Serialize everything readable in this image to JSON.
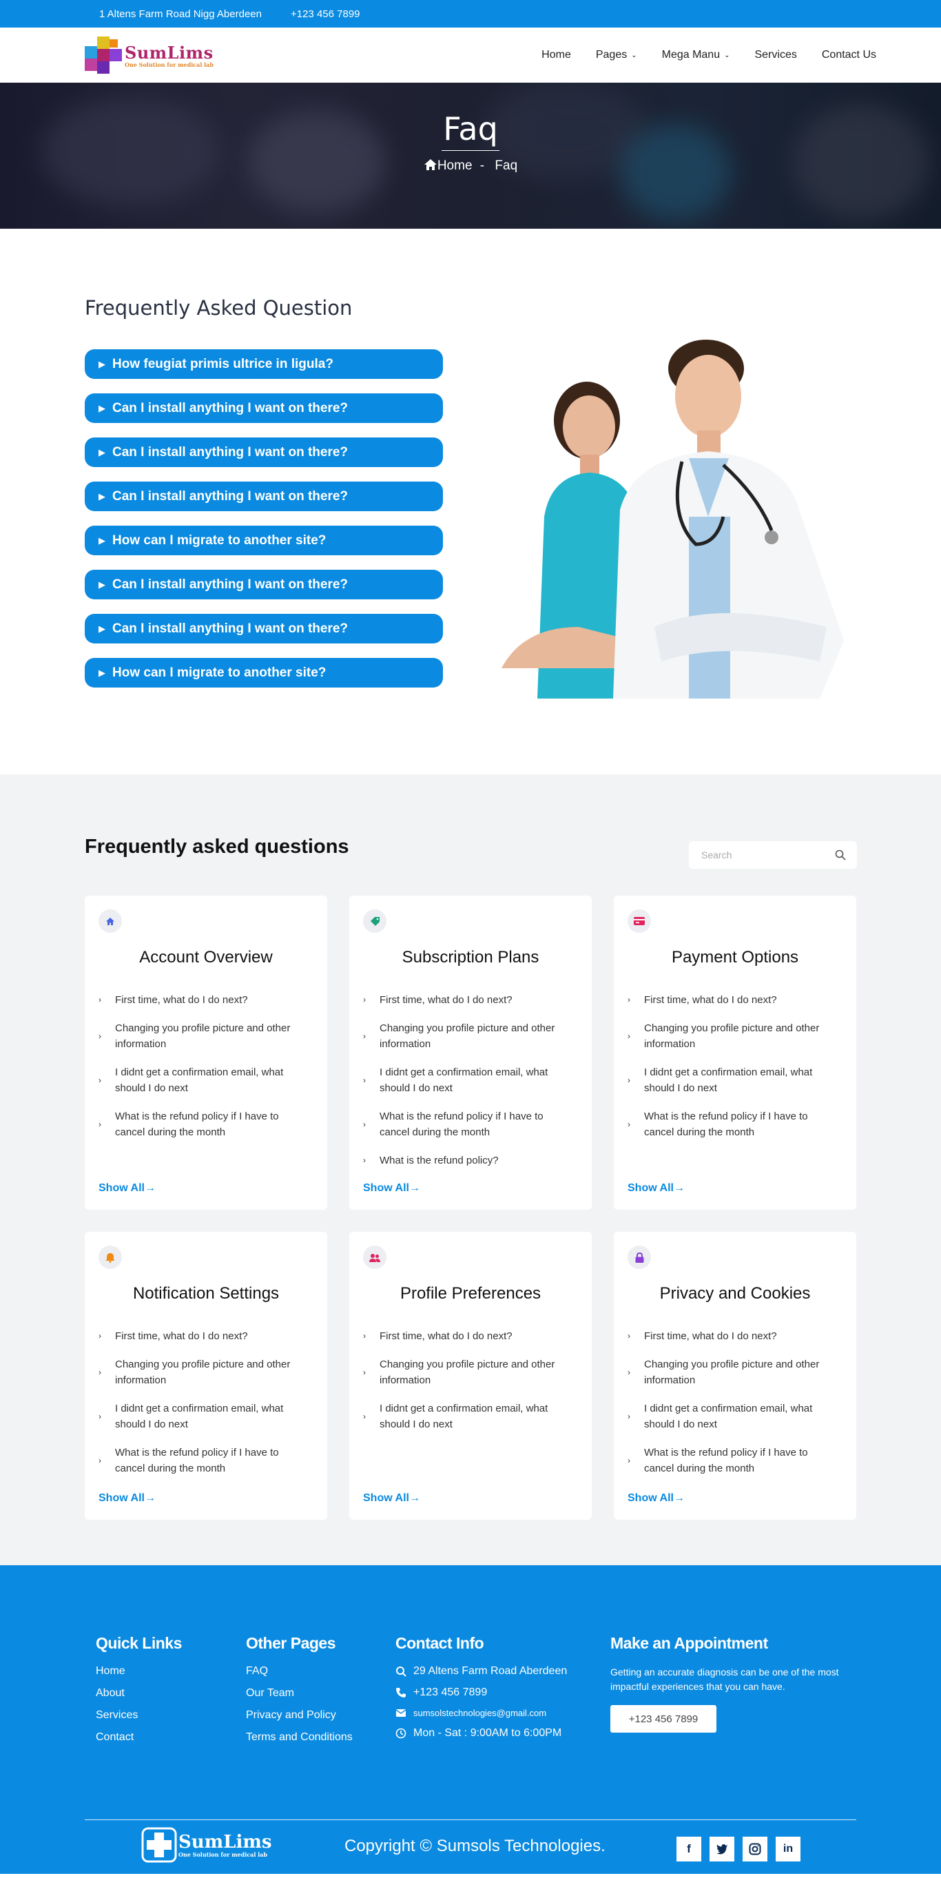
{
  "topbar": {
    "address": "1 Altens Farm Road Nigg Aberdeen",
    "phone": "+123 456 7899"
  },
  "brand": {
    "name": "SumLims",
    "tagline": "One Solution for medical lab"
  },
  "nav": [
    {
      "label": "Home",
      "dropdown": false
    },
    {
      "label": "Pages",
      "dropdown": true
    },
    {
      "label": "Mega Manu",
      "dropdown": true
    },
    {
      "label": "Services",
      "dropdown": false
    },
    {
      "label": "Contact Us",
      "dropdown": false
    }
  ],
  "hero": {
    "title": "Faq",
    "crumb_home": "Home",
    "crumb_sep": "-",
    "crumb_current": "Faq"
  },
  "faq_accordion": {
    "heading": "Frequently Asked Question",
    "items": [
      "How feugiat primis ultrice in ligula?",
      "Can I install anything I want on there?",
      "Can I install anything I want on there?",
      "Can I install anything I want on there?",
      "How can I migrate to another site?",
      "Can I install anything I want on there?",
      "Can I install anything I want on there?",
      "How can I migrate to another site?"
    ]
  },
  "faq_cards": {
    "heading": "Frequently asked questions",
    "search_placeholder": "Search",
    "show_all": "Show All",
    "cards": [
      {
        "title": "Account Overview",
        "icon": "home-icon",
        "icon_color": "#4a63e0",
        "items": [
          "First time, what do I do next?",
          "Changing you profile picture and other information",
          "I didnt get a confirmation email, what should I do next",
          "What is the refund policy if I have to cancel during the month"
        ]
      },
      {
        "title": "Subscription Plans",
        "icon": "tag-icon",
        "icon_color": "#1aa07a",
        "items": [
          "First time, what do I do next?",
          "Changing you profile picture and other information",
          "I didnt get a confirmation email, what should I do next",
          "What is the refund policy if I have to cancel during the month",
          "What is the refund policy?"
        ]
      },
      {
        "title": "Payment Options",
        "icon": "credit-card-icon",
        "icon_color": "#e0245e",
        "items": [
          "First time, what do I do next?",
          "Changing you profile picture and other information",
          "I didnt get a confirmation email, what should I do next",
          "What is the refund policy if I have to cancel during the month"
        ]
      },
      {
        "title": "Notification Settings",
        "icon": "bell-icon",
        "icon_color": "#f08a12",
        "items": [
          "First time, what do I do next?",
          "Changing you profile picture and other information",
          "I didnt get a confirmation email, what should I do next",
          "What is the refund policy if I have to cancel during the month"
        ]
      },
      {
        "title": "Profile Preferences",
        "icon": "users-icon",
        "icon_color": "#e0245e",
        "items": [
          "First time, what do I do next?",
          "Changing you profile picture and other information",
          "I didnt get a confirmation email, what should I do next"
        ]
      },
      {
        "title": "Privacy and Cookies",
        "icon": "lock-icon",
        "icon_color": "#8a3fd6",
        "items": [
          "First time, what do I do next?",
          "Changing you profile picture and other information",
          "I didnt get a confirmation email, what should I do next",
          "What is the refund policy if I have to cancel during the month"
        ]
      }
    ]
  },
  "footer": {
    "quick_links": {
      "heading": "Quick Links",
      "items": [
        "Home",
        "About",
        "Services",
        "Contact"
      ]
    },
    "other_pages": {
      "heading": "Other Pages",
      "items": [
        "FAQ",
        "Our Team",
        "Privacy and Policy",
        "Terms and Conditions"
      ]
    },
    "contact": {
      "heading": "Contact Info",
      "address": "29 Altens Farm Road Aberdeen",
      "phone": "+123 456 7899",
      "email": "sumsolstechnologies@gmail.com",
      "hours": "Mon - Sat : 9:00AM to 6:00PM"
    },
    "appointment": {
      "heading": "Make an Appointment",
      "text": "Getting an accurate diagnosis can be one of the most impactful experiences that you can have.",
      "button": "+123 456 7899"
    },
    "copyright": "Copyright © Sumsols Technologies.",
    "socials": [
      "facebook-icon",
      "twitter-icon",
      "instagram-icon",
      "linkedin-icon"
    ]
  }
}
